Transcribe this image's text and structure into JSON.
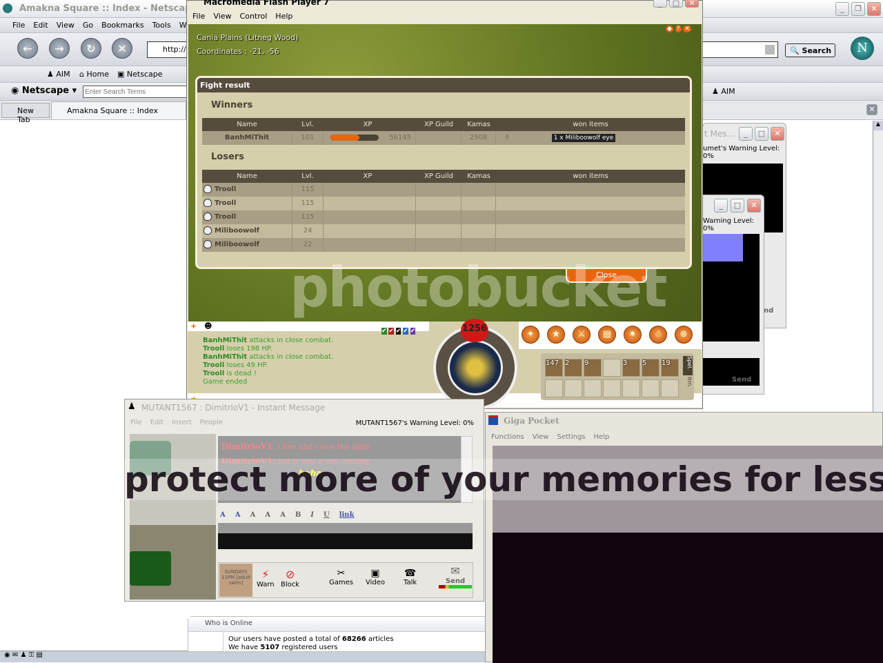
{
  "browser": {
    "title": "Amakna Square :: Index - Netscape",
    "menu": [
      "File",
      "Edit",
      "View",
      "Go",
      "Bookmarks",
      "Tools",
      "Window"
    ],
    "url": "http://",
    "search_button": "Search",
    "bookmarks": [
      "AIM",
      "Home",
      "Netscape"
    ],
    "netscape_label": "Netscape",
    "search_placeholder": "Enter Search Terms",
    "right_aim": "AIM",
    "tabs": [
      "New Tab",
      "Amakna Square :: Index"
    ]
  },
  "flash": {
    "title": "Macromedia Flash Player 7",
    "menu": [
      "File",
      "View",
      "Control",
      "Help"
    ],
    "location": "Cania Plains (Litneg Wood)",
    "coordinates": "Coordinates : -21, -56",
    "fight_result": {
      "title": "Fight result",
      "winners_label": "Winners",
      "losers_label": "Losers",
      "columns": [
        "Name",
        "Lvl.",
        "XP",
        "XP Guild",
        "Kamas",
        "won items"
      ],
      "winners": [
        {
          "name": "BanhMiThit",
          "lvl": "101",
          "xp": "56145",
          "xp_progress": 0.6,
          "xp_guild": "",
          "kamas": "2508",
          "won_item": "1 x Miliboowolf eye"
        }
      ],
      "losers": [
        {
          "name": "Trooll",
          "lvl": "115"
        },
        {
          "name": "Trooll",
          "lvl": "115"
        },
        {
          "name": "Trooll",
          "lvl": "115"
        },
        {
          "name": "Miliboowolf",
          "lvl": "24"
        },
        {
          "name": "Miliboowolf",
          "lvl": "22"
        }
      ],
      "close_label": "Close"
    },
    "chat_log": [
      {
        "who": "BanhMiThit",
        "text": " attacks in close combat."
      },
      {
        "who": "Trooll",
        "text": " loses 198 HP."
      },
      {
        "who": "BanhMiThit",
        "text": " attacks in close combat."
      },
      {
        "who": "Trooll",
        "text": " loses 49 HP."
      },
      {
        "who": "Trooll",
        "text": " is dead !"
      },
      {
        "who": "",
        "text": "Game ended"
      }
    ],
    "hp": "1256",
    "inventory_counts": [
      "147",
      "2",
      "9",
      "",
      "3",
      "5",
      "19"
    ],
    "tab_spells": "Spel.",
    "tab_items": "Itm.",
    "accent": "#e8650f"
  },
  "aim_main": {
    "title": "MUTANT1567 : DimitrioV1 - Instant Message",
    "menu": [
      "File",
      "Edit",
      "Insert",
      "People"
    ],
    "warning": "MUTANT1567's Warning Level: 0%",
    "messages": [
      {
        "who": "DimitrioV1",
        "text": ": i live and i saw the light"
      },
      {
        "who": "DimitrioV1",
        "text": ": but ti was a van coming"
      }
    ],
    "reply": "haha",
    "toolbar": [
      "A",
      "A",
      "A",
      "A",
      "A",
      "B",
      "I",
      "U",
      "link"
    ],
    "buddy_icon_text": "SUNDAYS 11PM [adult swim]",
    "buttons": [
      "Warn",
      "Block",
      "Games",
      "Video",
      "Talk",
      "Send"
    ]
  },
  "aim_back1": {
    "title": "t Mes...",
    "warning": "umet's Warning Level: 0%",
    "send": "nd"
  },
  "aim_back2": {
    "warning": "Warning Level: 0%",
    "send": "Send"
  },
  "giga_pocket": {
    "title": "Giga Pocket",
    "menu": [
      "Functions",
      "View",
      "Settings",
      "Help"
    ]
  },
  "page": {
    "who_online": "Who is Online",
    "line1_pre": "Our users have posted a total of ",
    "line1_num": "68266",
    "line1_post": " articles",
    "line2_pre": "We have ",
    "line2_num": "5107",
    "line2_post": " registered users"
  },
  "watermark": {
    "brand": "photobucket",
    "slogan": "protect more of your memories for less!"
  }
}
